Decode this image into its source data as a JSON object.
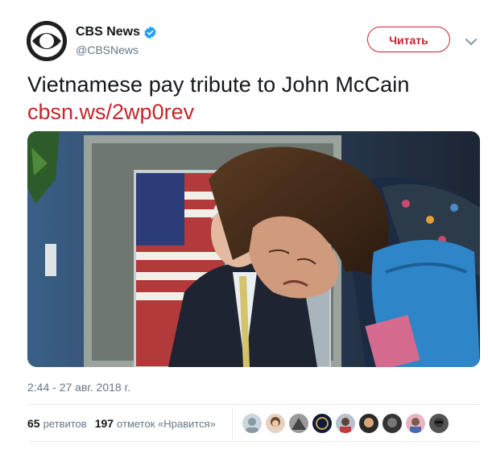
{
  "account": {
    "name": "CBS News",
    "handle": "@CBSNews",
    "follow_label": "Читать"
  },
  "tweet": {
    "text": "Vietnamese pay tribute to John McCain",
    "link": "cbsn.ws/2wp0rev",
    "timestamp": "2:44 - 27 авг. 2018 г."
  },
  "stats": {
    "retweets_count": "65",
    "retweets_label": "ретвитов",
    "likes_count": "197",
    "likes_label": "отметок «Нравится»"
  },
  "colors": {
    "accent": "#c1272d",
    "verified": "#1da1f2",
    "secondary_text": "#657786"
  },
  "icons": [
    "cbs-eye-logo-icon",
    "verified-badge-icon",
    "chevron-down-icon"
  ]
}
